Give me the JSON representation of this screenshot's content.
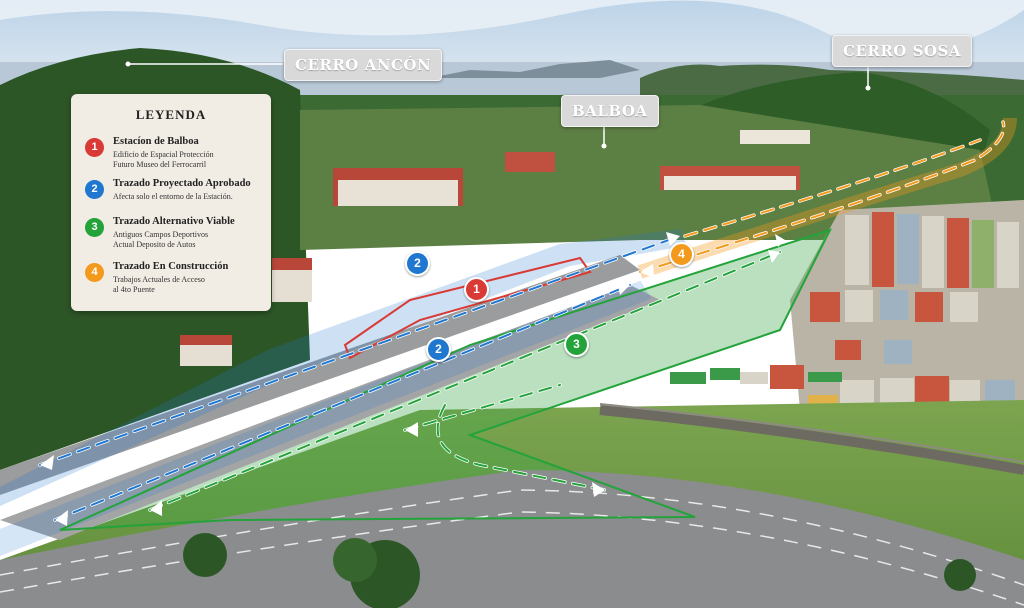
{
  "labels": {
    "cerro_ancon": "CERRO ANCÓN",
    "cerro_sosa": "CERRO SOSA",
    "balboa": "BALBOA"
  },
  "legend": {
    "title": "LEYENDA",
    "items": [
      {
        "num": "1",
        "color": "#d93a35",
        "title": "Estacíon de Balboa",
        "sub1": "Edificio de Espacial Protección",
        "sub2": "Futuro Museo del Ferrocarril"
      },
      {
        "num": "2",
        "color": "#1f77d0",
        "title": "Trazado Proyectado Aprobado",
        "sub1": "Afecta solo el entorno de la Estación.",
        "sub2": ""
      },
      {
        "num": "3",
        "color": "#23a33a",
        "title": "Trazado Alternativo Viable",
        "sub1": "Antiguos Campos Deportivos",
        "sub2": "Actual Deposito de Autos"
      },
      {
        "num": "4",
        "color": "#f39a1c",
        "title": "Trazado En Construcción",
        "sub1": "Trabajos Actuales de Acceso",
        "sub2": "al 4to Puente"
      }
    ]
  },
  "markers": {
    "red": "1",
    "blue": "2",
    "green": "3",
    "orange": "4"
  },
  "colors": {
    "red": "#d93a35",
    "blue": "#1f77d0",
    "green": "#23a33a",
    "orange": "#f39a1c",
    "sky": "#cfe0ef",
    "forest": "#2f5a2a",
    "grass": "#6f9a45",
    "highway": "#8a8c8e"
  }
}
